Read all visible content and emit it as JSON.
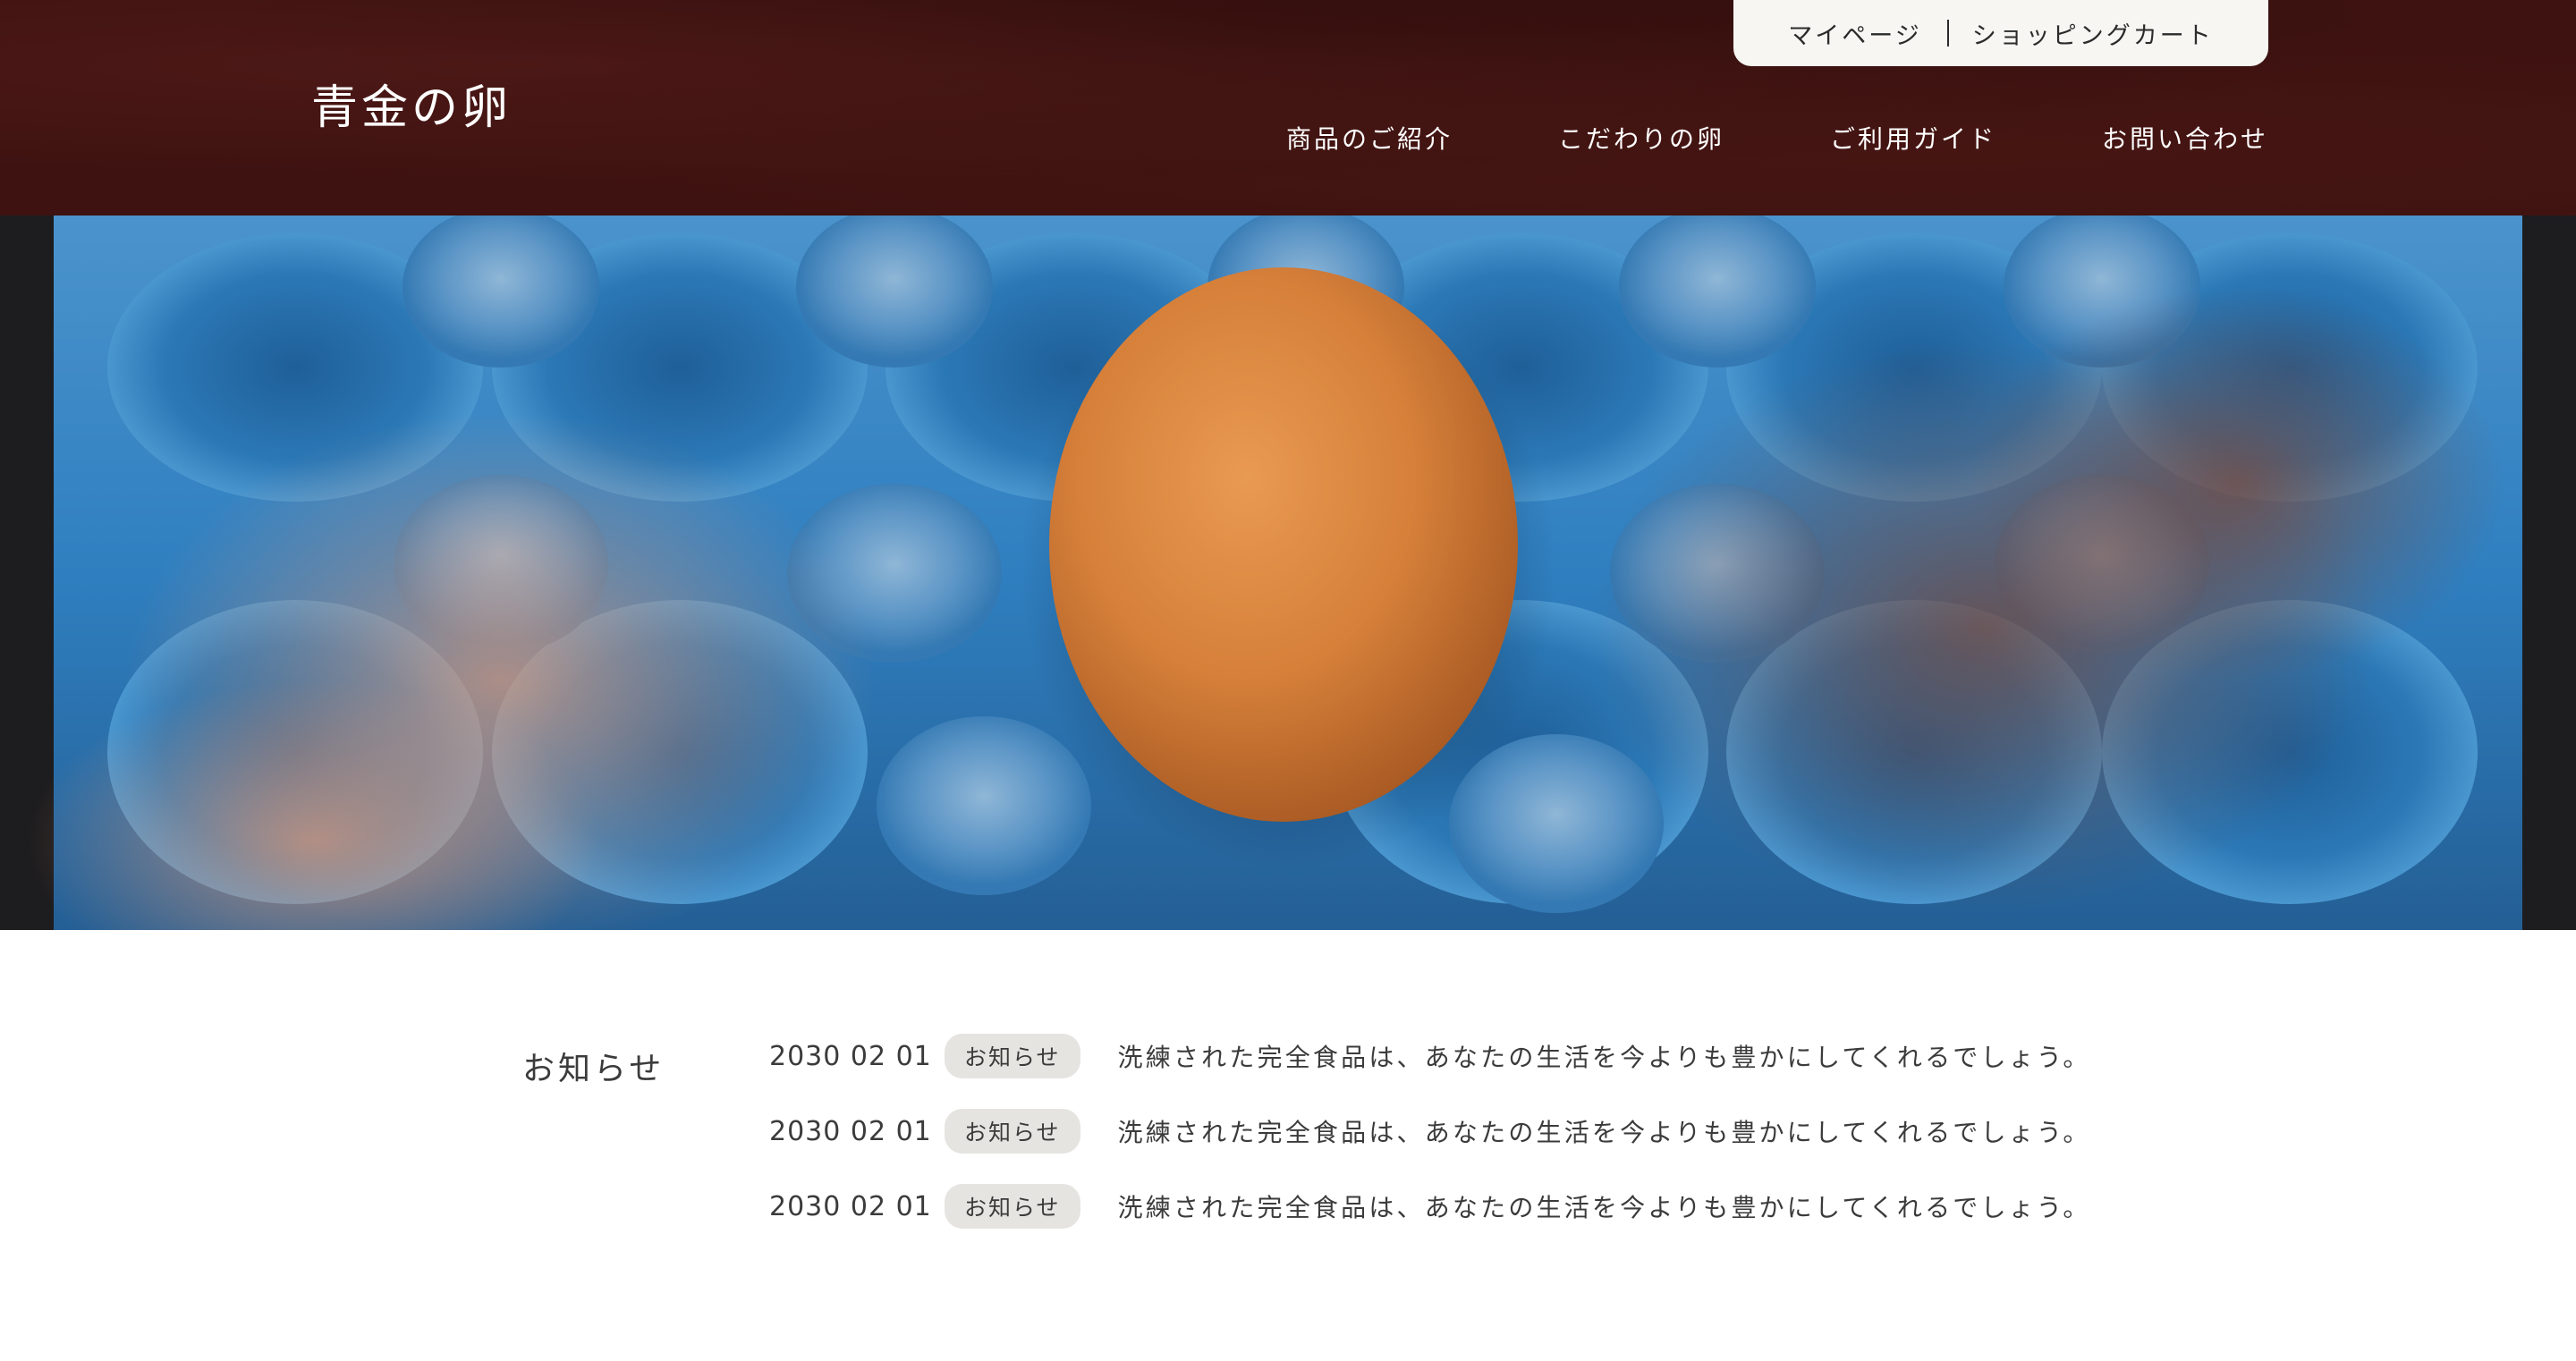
{
  "header": {
    "logo": "青金の卵",
    "utility": {
      "mypage": "マイページ",
      "cart": "ショッピングカート"
    },
    "nav": [
      {
        "label": "商品のご紹介"
      },
      {
        "label": "こだわりの卵"
      },
      {
        "label": "ご利用ガイド"
      },
      {
        "label": "お問い合わせ"
      }
    ]
  },
  "hero": {
    "carton_color": "#2f7fc0",
    "egg_color": "#d6803a",
    "header_color": "#3d1210"
  },
  "news": {
    "title": "お知らせ",
    "items": [
      {
        "date": "2030 02 01",
        "badge": "お知らせ",
        "text": "洗練された完全食品は、あなたの生活を今よりも豊かにしてくれるでしょう。"
      },
      {
        "date": "2030 02 01",
        "badge": "お知らせ",
        "text": "洗練された完全食品は、あなたの生活を今よりも豊かにしてくれるでしょう。"
      },
      {
        "date": "2030 02 01",
        "badge": "お知らせ",
        "text": "洗練された完全食品は、あなたの生活を今よりも豊かにしてくれるでしょう。"
      }
    ]
  }
}
